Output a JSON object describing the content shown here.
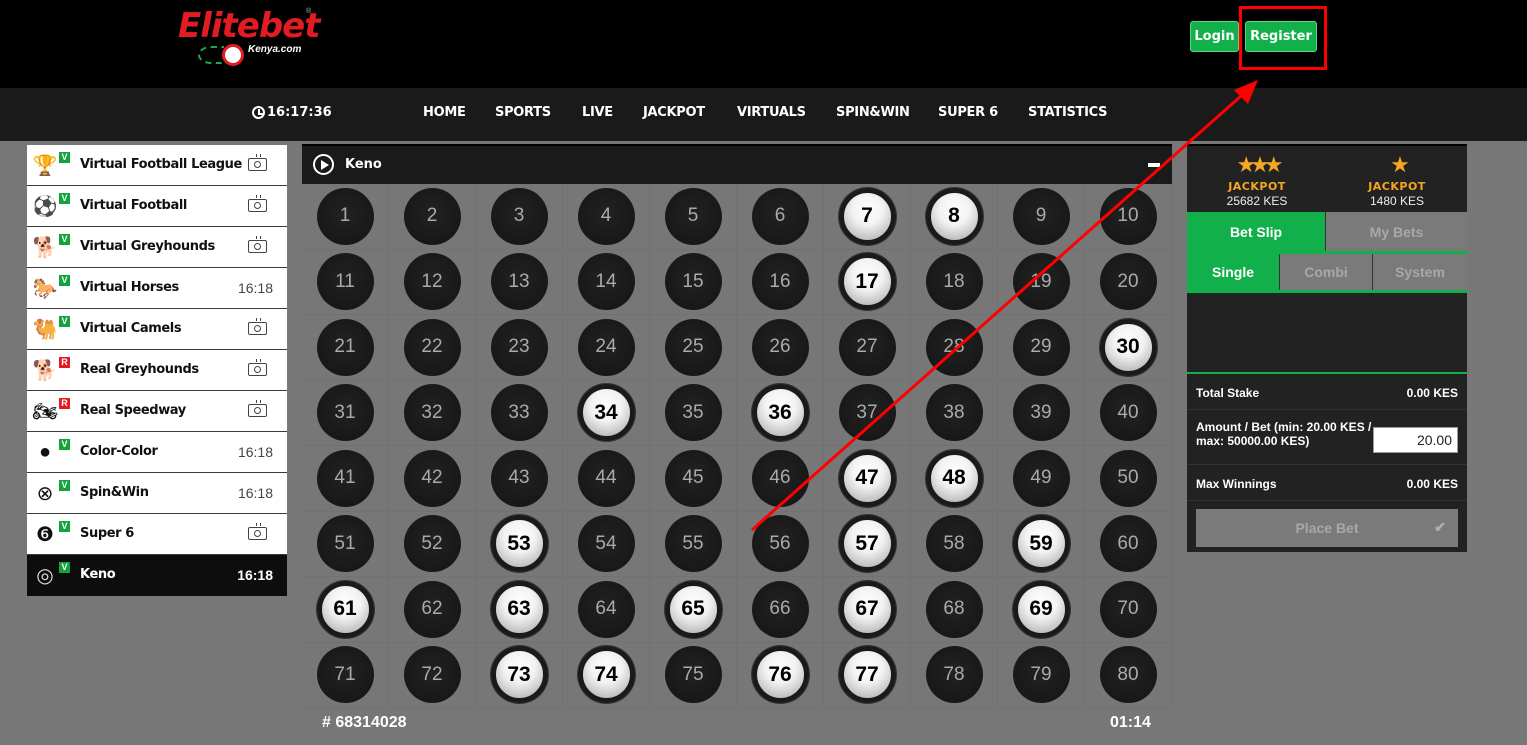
{
  "header": {
    "logo_text": "Elitebet",
    "logo_sub": "Kenya.com",
    "logo_registered": "®",
    "login_label": "Login",
    "register_label": "Register"
  },
  "navbar": {
    "clock_icon": "clock-icon",
    "time": "16:17:36",
    "items": [
      "HOME",
      "SPORTS",
      "LIVE",
      "JACKPOT",
      "VIRTUALS",
      "SPIN&WIN",
      "SUPER 6",
      "STATISTICS"
    ]
  },
  "sidebar": {
    "items": [
      {
        "label": "Virtual Football League",
        "icon": "trophy-icon",
        "badge": "V",
        "status": "tv-icon",
        "time": ""
      },
      {
        "label": "Virtual Football",
        "icon": "footballer-icon",
        "badge": "V",
        "status": "tv-icon",
        "time": ""
      },
      {
        "label": "Virtual Greyhounds",
        "icon": "greyhound-icon",
        "badge": "V",
        "status": "tv-icon",
        "time": ""
      },
      {
        "label": "Virtual Horses",
        "icon": "horse-icon",
        "badge": "V",
        "status": "time",
        "time": "16:18"
      },
      {
        "label": "Virtual Camels",
        "icon": "camel-icon",
        "badge": "V",
        "status": "tv-icon",
        "time": ""
      },
      {
        "label": "Real Greyhounds",
        "icon": "greyhound-icon",
        "badge": "R",
        "status": "tv-icon",
        "time": ""
      },
      {
        "label": "Real Speedway",
        "icon": "motorcycle-icon",
        "badge": "R",
        "status": "tv-icon",
        "time": ""
      },
      {
        "label": "Color-Color",
        "icon": "balls-icon",
        "badge": "V",
        "status": "time",
        "time": "16:18"
      },
      {
        "label": "Spin&Win",
        "icon": "roulette-icon",
        "badge": "V",
        "status": "time",
        "time": "16:18"
      },
      {
        "label": "Super 6",
        "icon": "super6-icon",
        "badge": "V",
        "status": "tv-icon",
        "time": ""
      },
      {
        "label": "Keno",
        "icon": "keno-icon",
        "badge": "V",
        "status": "time",
        "time": "16:18",
        "active": true
      }
    ]
  },
  "keno": {
    "title": "Keno",
    "numbers_total": 80,
    "drawn": [
      7,
      8,
      17,
      30,
      34,
      36,
      47,
      48,
      53,
      57,
      59,
      61,
      63,
      65,
      67,
      69,
      73,
      74,
      76,
      77
    ],
    "draw_id": "# 68314028",
    "countdown": "01:14"
  },
  "betslip": {
    "jackpots": [
      {
        "label": "JACKPOT",
        "amount": "25682 KES",
        "stars": 3
      },
      {
        "label": "JACKPOT",
        "amount": "1480 KES",
        "stars": 1
      }
    ],
    "tabs": [
      {
        "label": "Bet Slip",
        "active": true
      },
      {
        "label": "My Bets",
        "active": false
      }
    ],
    "subtabs": [
      {
        "label": "Single",
        "active": true
      },
      {
        "label": "Combi",
        "active": false
      },
      {
        "label": "System",
        "active": false
      }
    ],
    "total_stake_label": "Total Stake",
    "total_stake_value": "0.00 KES",
    "amount_label": "Amount / Bet (min: 20.00 KES / max: 50000.00 KES)",
    "amount_value": "20.00",
    "max_winnings_label": "Max Winnings",
    "max_winnings_value": "0.00 KES",
    "place_bet_label": "Place Bet",
    "place_bet_icon": "checkmark-icon"
  },
  "colors": {
    "brand_red": "#e31b23",
    "brand_green": "#12b04a",
    "jackpot_gold": "#f5a623",
    "annotation_red": "#ff0000"
  }
}
